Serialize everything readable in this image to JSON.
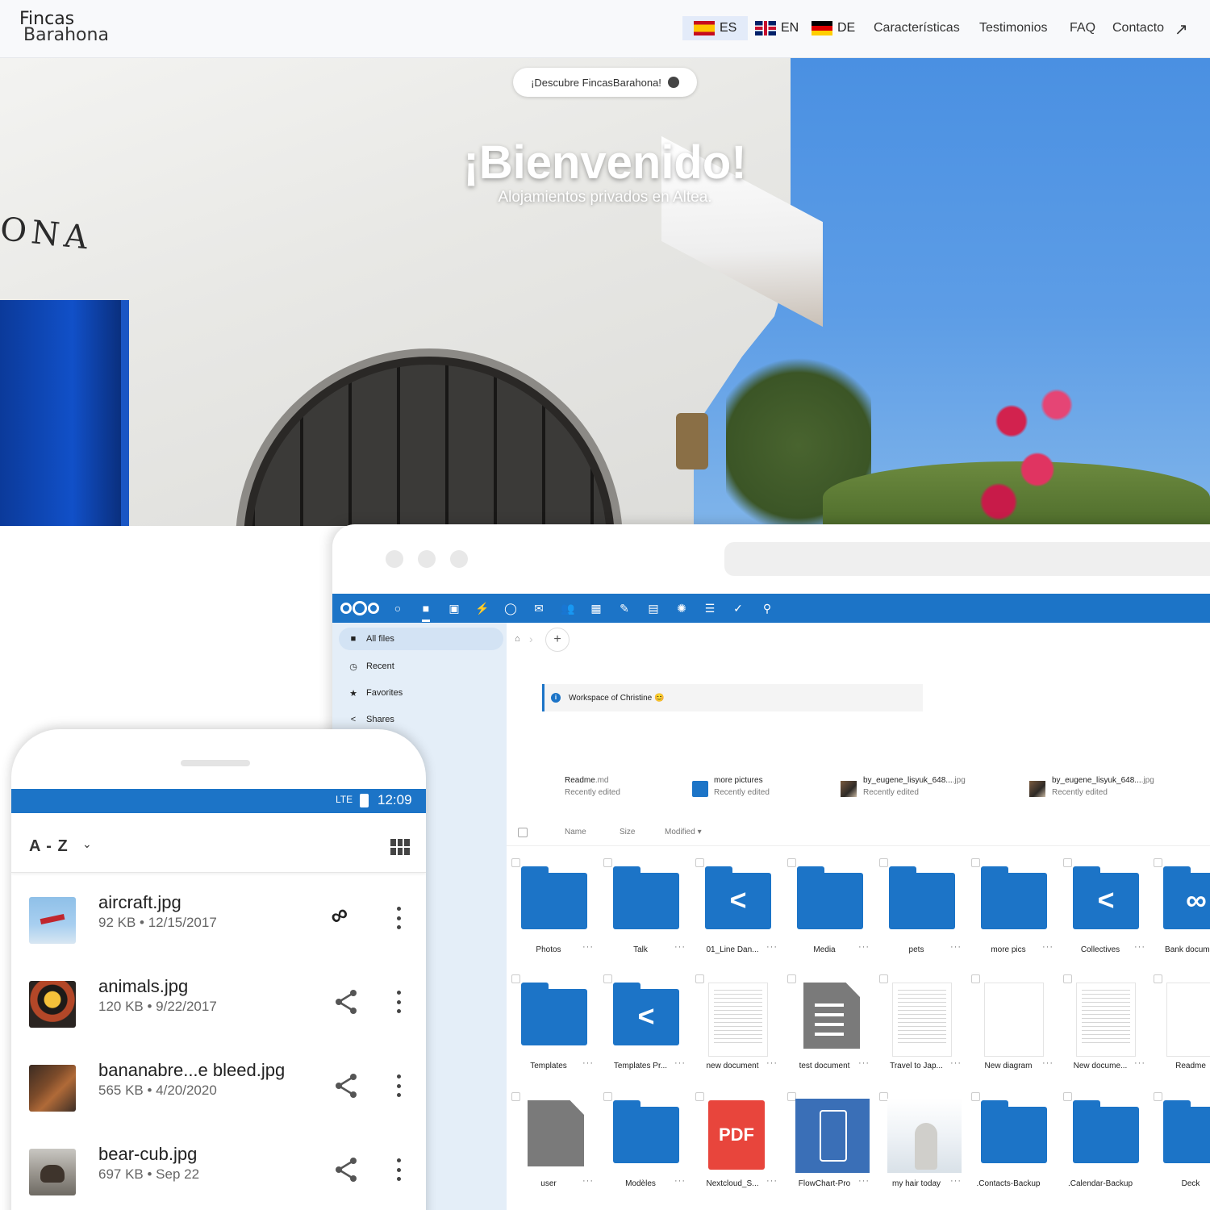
{
  "site": {
    "logo_line1": "Fincas",
    "logo_line2": "Barahona",
    "languages": [
      {
        "code": "ES",
        "active": true
      },
      {
        "code": "EN",
        "active": false
      },
      {
        "code": "DE",
        "active": false
      }
    ],
    "nav": [
      "Características",
      "Testimonios",
      "FAQ",
      "Contacto"
    ],
    "external_icon": "arrow-up-right-icon"
  },
  "hero": {
    "pill": "¡Descubre FincasBarahona!",
    "title": "¡Bienvenido!",
    "subtitle": "Alojamientos privados en Altea.",
    "sign": "ONA"
  },
  "desktop": {
    "sidebar": [
      "All files",
      "Recent",
      "Favorites",
      "Shares"
    ],
    "workspace": "Workspace of Christine 😊",
    "recent": [
      {
        "name": "Readme",
        "ext": ".md",
        "status": "Recently edited"
      },
      {
        "name": "more pictures",
        "ext": "",
        "status": "Recently edited"
      },
      {
        "name": "by_eugene_lisyuk_648...",
        "ext": ".jpg",
        "status": "Recently edited"
      },
      {
        "name": "by_eugene_lisyuk_648...",
        "ext": ".jpg",
        "status": "Recently edited"
      }
    ],
    "columns": {
      "name": "Name",
      "size": "Size",
      "modified": "Modified ▾"
    },
    "files_row1": [
      "Photos",
      "Talk",
      "01_Line Dan...",
      "Media",
      "pets",
      "more pics",
      "Collectives",
      "Bank docum..."
    ],
    "files_row2": [
      "Templates",
      "Templates Pr...",
      "new document",
      "test document",
      "Travel to Jap...",
      "New diagram",
      "New docume...",
      "Readme"
    ],
    "files_row3": [
      "user",
      "Modèles",
      "Nextcloud_S...",
      "FlowChart-Pro",
      "my hair today",
      ".Contacts-Backup",
      ".Calendar-Backup",
      "Deck"
    ],
    "pdf_label": "PDF"
  },
  "mobile": {
    "network": "LTE",
    "time": "12:09",
    "sort": "A - Z",
    "files": [
      {
        "name": "aircraft.jpg",
        "meta": "92 KB • 12/15/2017",
        "action": "link"
      },
      {
        "name": "animals.jpg",
        "meta": "120 KB • 9/22/2017",
        "action": "share"
      },
      {
        "name": "bananabre...e bleed.jpg",
        "meta": "565 KB • 4/20/2020",
        "action": "share"
      },
      {
        "name": "bear-cub.jpg",
        "meta": "697 KB • Sep 22",
        "action": "share"
      }
    ]
  },
  "colors": {
    "brand_blue": "#1c74c7",
    "folder_blue": "#1c74c7",
    "pdf_red": "#e8453c"
  }
}
